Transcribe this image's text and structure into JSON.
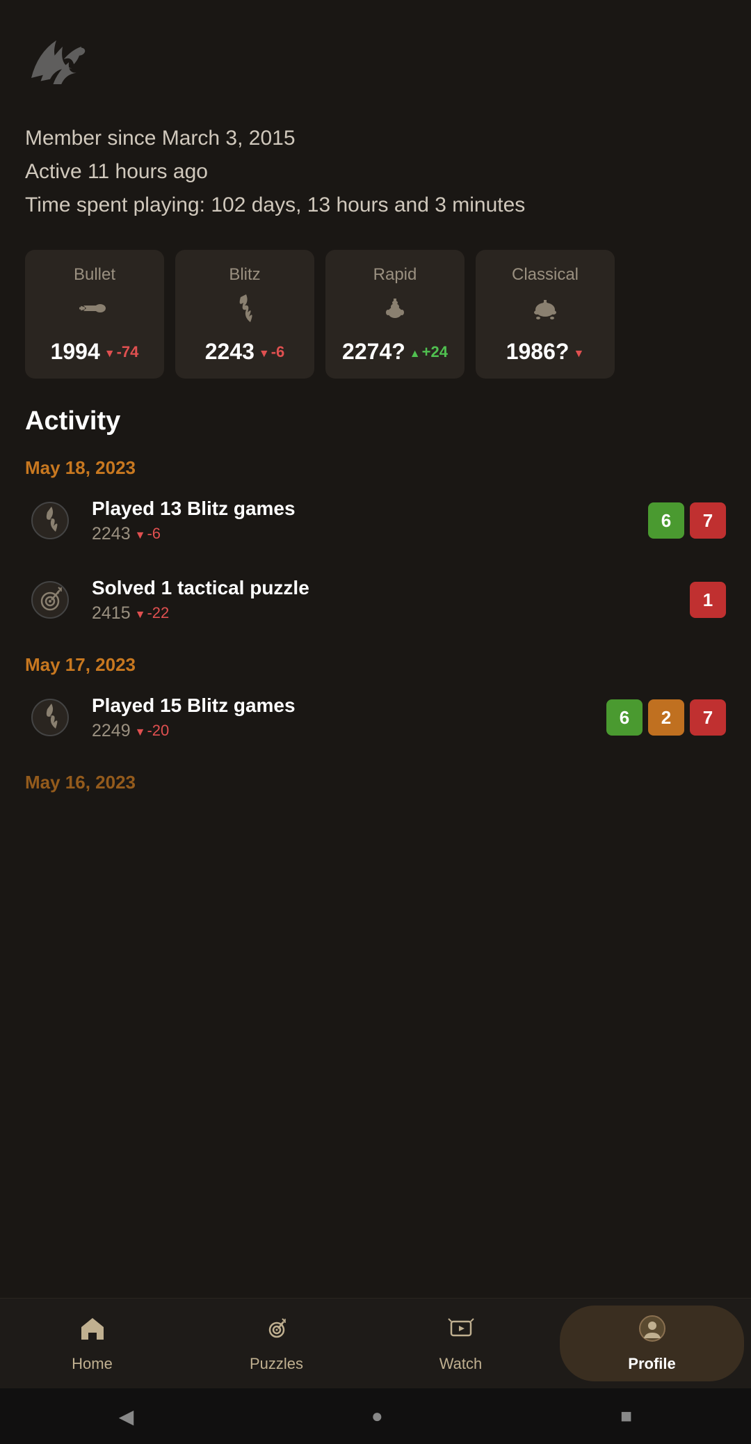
{
  "logo": {
    "alt": "Lichess logo"
  },
  "profile": {
    "member_since": "Member since March 3, 2015",
    "active": "Active 11 hours ago",
    "time_spent": "Time spent playing: 102 days, 13 hours and 3 minutes"
  },
  "ratings": [
    {
      "id": "bullet",
      "label": "Bullet",
      "icon": "bullet",
      "value": "1994",
      "change": "-74",
      "direction": "down"
    },
    {
      "id": "blitz",
      "label": "Blitz",
      "icon": "blitz",
      "value": "2243",
      "change": "-6",
      "direction": "down"
    },
    {
      "id": "rapid",
      "label": "Rapid",
      "icon": "rapid",
      "value": "2274?",
      "change": "+24",
      "direction": "up"
    },
    {
      "id": "classical",
      "label": "Classical",
      "icon": "classical",
      "value": "1986?",
      "change": "",
      "direction": "down"
    }
  ],
  "activity": {
    "title": "Activity",
    "dates": [
      {
        "date": "May 18, 2023",
        "items": [
          {
            "type": "blitz",
            "main": "Played 13 Blitz games",
            "sub_value": "2243",
            "sub_change": "-6",
            "sub_direction": "down",
            "badges": [
              {
                "value": "6",
                "color": "green"
              },
              {
                "value": "7",
                "color": "red"
              }
            ]
          },
          {
            "type": "puzzle",
            "main": "Solved 1 tactical puzzle",
            "sub_value": "2415",
            "sub_change": "-22",
            "sub_direction": "down",
            "badges": [
              {
                "value": "1",
                "color": "red"
              }
            ]
          }
        ]
      },
      {
        "date": "May 17, 2023",
        "items": [
          {
            "type": "blitz",
            "main": "Played 15 Blitz games",
            "sub_value": "2249",
            "sub_change": "-20",
            "sub_direction": "down",
            "badges": [
              {
                "value": "6",
                "color": "green"
              },
              {
                "value": "2",
                "color": "orange"
              },
              {
                "value": "7",
                "color": "red"
              }
            ]
          }
        ]
      },
      {
        "date": "May 16, 2023",
        "items": []
      }
    ]
  },
  "nav": {
    "items": [
      {
        "id": "home",
        "label": "Home",
        "icon": "home",
        "active": false
      },
      {
        "id": "puzzles",
        "label": "Puzzles",
        "icon": "puzzles",
        "active": false
      },
      {
        "id": "watch",
        "label": "Watch",
        "icon": "watch",
        "active": false
      },
      {
        "id": "profile",
        "label": "Profile",
        "icon": "profile",
        "active": true
      }
    ]
  },
  "system_nav": {
    "back": "◀",
    "home": "●",
    "recent": "■"
  }
}
